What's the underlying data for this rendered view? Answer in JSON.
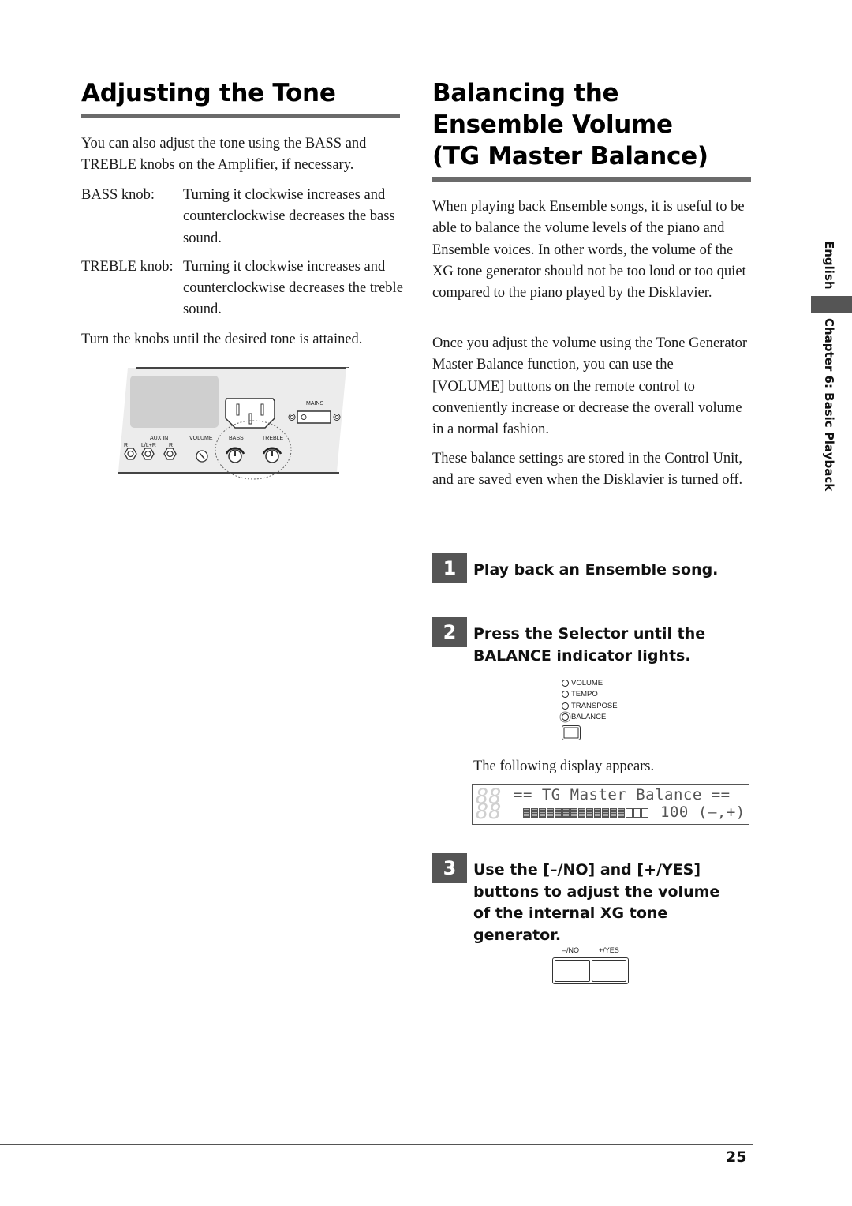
{
  "left_section": {
    "title": "Adjusting the Tone",
    "intro": "You can also adjust the tone using the BASS and TREBLE knobs on the Amplifier, if necessary.",
    "definitions": [
      {
        "term": "BASS knob:",
        "desc": "Turning it clockwise increases and counterclockwise decreases the bass sound."
      },
      {
        "term": "TREBLE knob:",
        "desc": "Turning it clockwise increases and counterclockwise decreases the treble sound."
      }
    ],
    "closing": "Turn the knobs until the desired tone is attained.",
    "amp_panel": {
      "mains_label": "MAINS",
      "aux_in_label": "AUX IN",
      "l_label": "L/L+R",
      "r_label": "R",
      "r_left_label": "R",
      "volume_label": "VOLUME",
      "bass_label": "BASS",
      "treble_label": "TREBLE"
    }
  },
  "right_section": {
    "title_lines": [
      "Balancing the",
      "Ensemble Volume",
      "(TG Master Balance)"
    ],
    "paragraphs": [
      "When playing back Ensemble songs, it is useful to be able to balance the volume levels of the piano and Ensemble voices. In other words, the volume of the XG tone generator should not be too loud or too quiet compared to the piano played by the Disklavier.",
      "Once you adjust the volume using the Tone Generator Master Balance function, you can use the [VOLUME] buttons on the remote control to conveniently increase or decrease the overall volume in a normal fashion.",
      "These balance settings are stored in the Control Unit, and are saved even when the Disklavier is turned off."
    ],
    "steps": [
      {
        "number": "1",
        "text": "Play back an Ensemble song."
      },
      {
        "number": "2",
        "text": "Press the Selector until the BALANCE indicator lights."
      },
      {
        "number": "3",
        "text": "Use the [–/NO] and [+/YES] buttons to adjust the volume of the internal XG tone generator."
      }
    ],
    "indicators": [
      {
        "label": "VOLUME",
        "lit": false
      },
      {
        "label": "TEMPO",
        "lit": false
      },
      {
        "label": "TRANSPOSE",
        "lit": false
      },
      {
        "label": "BALANCE",
        "lit": true
      }
    ],
    "display_caption": "The following display appears.",
    "lcd": {
      "segment": "88",
      "line1": "== TG Master Balance ==",
      "bar_filled": 13,
      "bar_empty": 3,
      "value": "100",
      "hint": "(–,+)"
    },
    "buttons": {
      "no_label": "–/NO",
      "yes_label": "+/YES"
    }
  },
  "side_tab": {
    "language": "English",
    "chapter": "Chapter 6:  Basic Playback"
  },
  "footer": {
    "page_number": "25"
  }
}
